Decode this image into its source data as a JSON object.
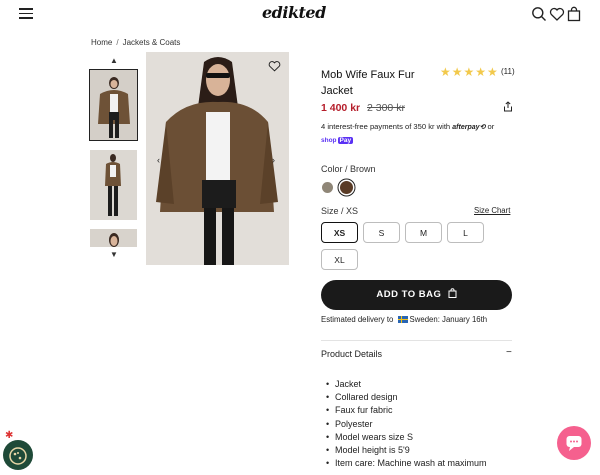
{
  "header": {
    "logo": "edikted",
    "icons": [
      "menu-icon",
      "search-icon",
      "heart-icon",
      "bag-icon"
    ]
  },
  "breadcrumb": {
    "home": "Home",
    "sep": "/",
    "category": "Jackets & Coats"
  },
  "product": {
    "title": "Mob Wife Faux Fur Jacket",
    "rating_count": "(11)",
    "stars": "★★★★★",
    "rating": 5,
    "price": "1 400 kr",
    "old_price": "2 300 kr",
    "installments_text": "4 interest-free payments of 350 kr with",
    "afterpay": "afterpay⟲",
    "or": "or",
    "shoppay_shop": "shop",
    "shoppay_pay": "Pay",
    "color_label": "Color",
    "color_sep": " / ",
    "color_value": "Brown",
    "swatch_colors": [
      "#8f8677",
      "#5a3b26"
    ],
    "size_label": "Size",
    "size_sep": " / ",
    "size_value": "XS",
    "size_chart": "Size Chart",
    "sizes": [
      "XS",
      "S",
      "M",
      "L",
      "XL"
    ],
    "add_to_bag": "ADD TO BAG",
    "delivery_prefix": "Estimated delivery to",
    "delivery_suffix": "Sweden: January 16th",
    "details_title": "Product Details",
    "details_toggle": "−",
    "details": [
      "Jacket",
      "Collared design",
      "Faux fur fabric",
      "Polyester",
      "Model wears size S",
      "Model height is 5'9",
      "Item care: Machine wash at maximum"
    ]
  },
  "colors": {
    "accent_price": "#b51d2a",
    "button": "#1a1a1a",
    "chat": "#f5608e",
    "star": "#f2c94c"
  }
}
